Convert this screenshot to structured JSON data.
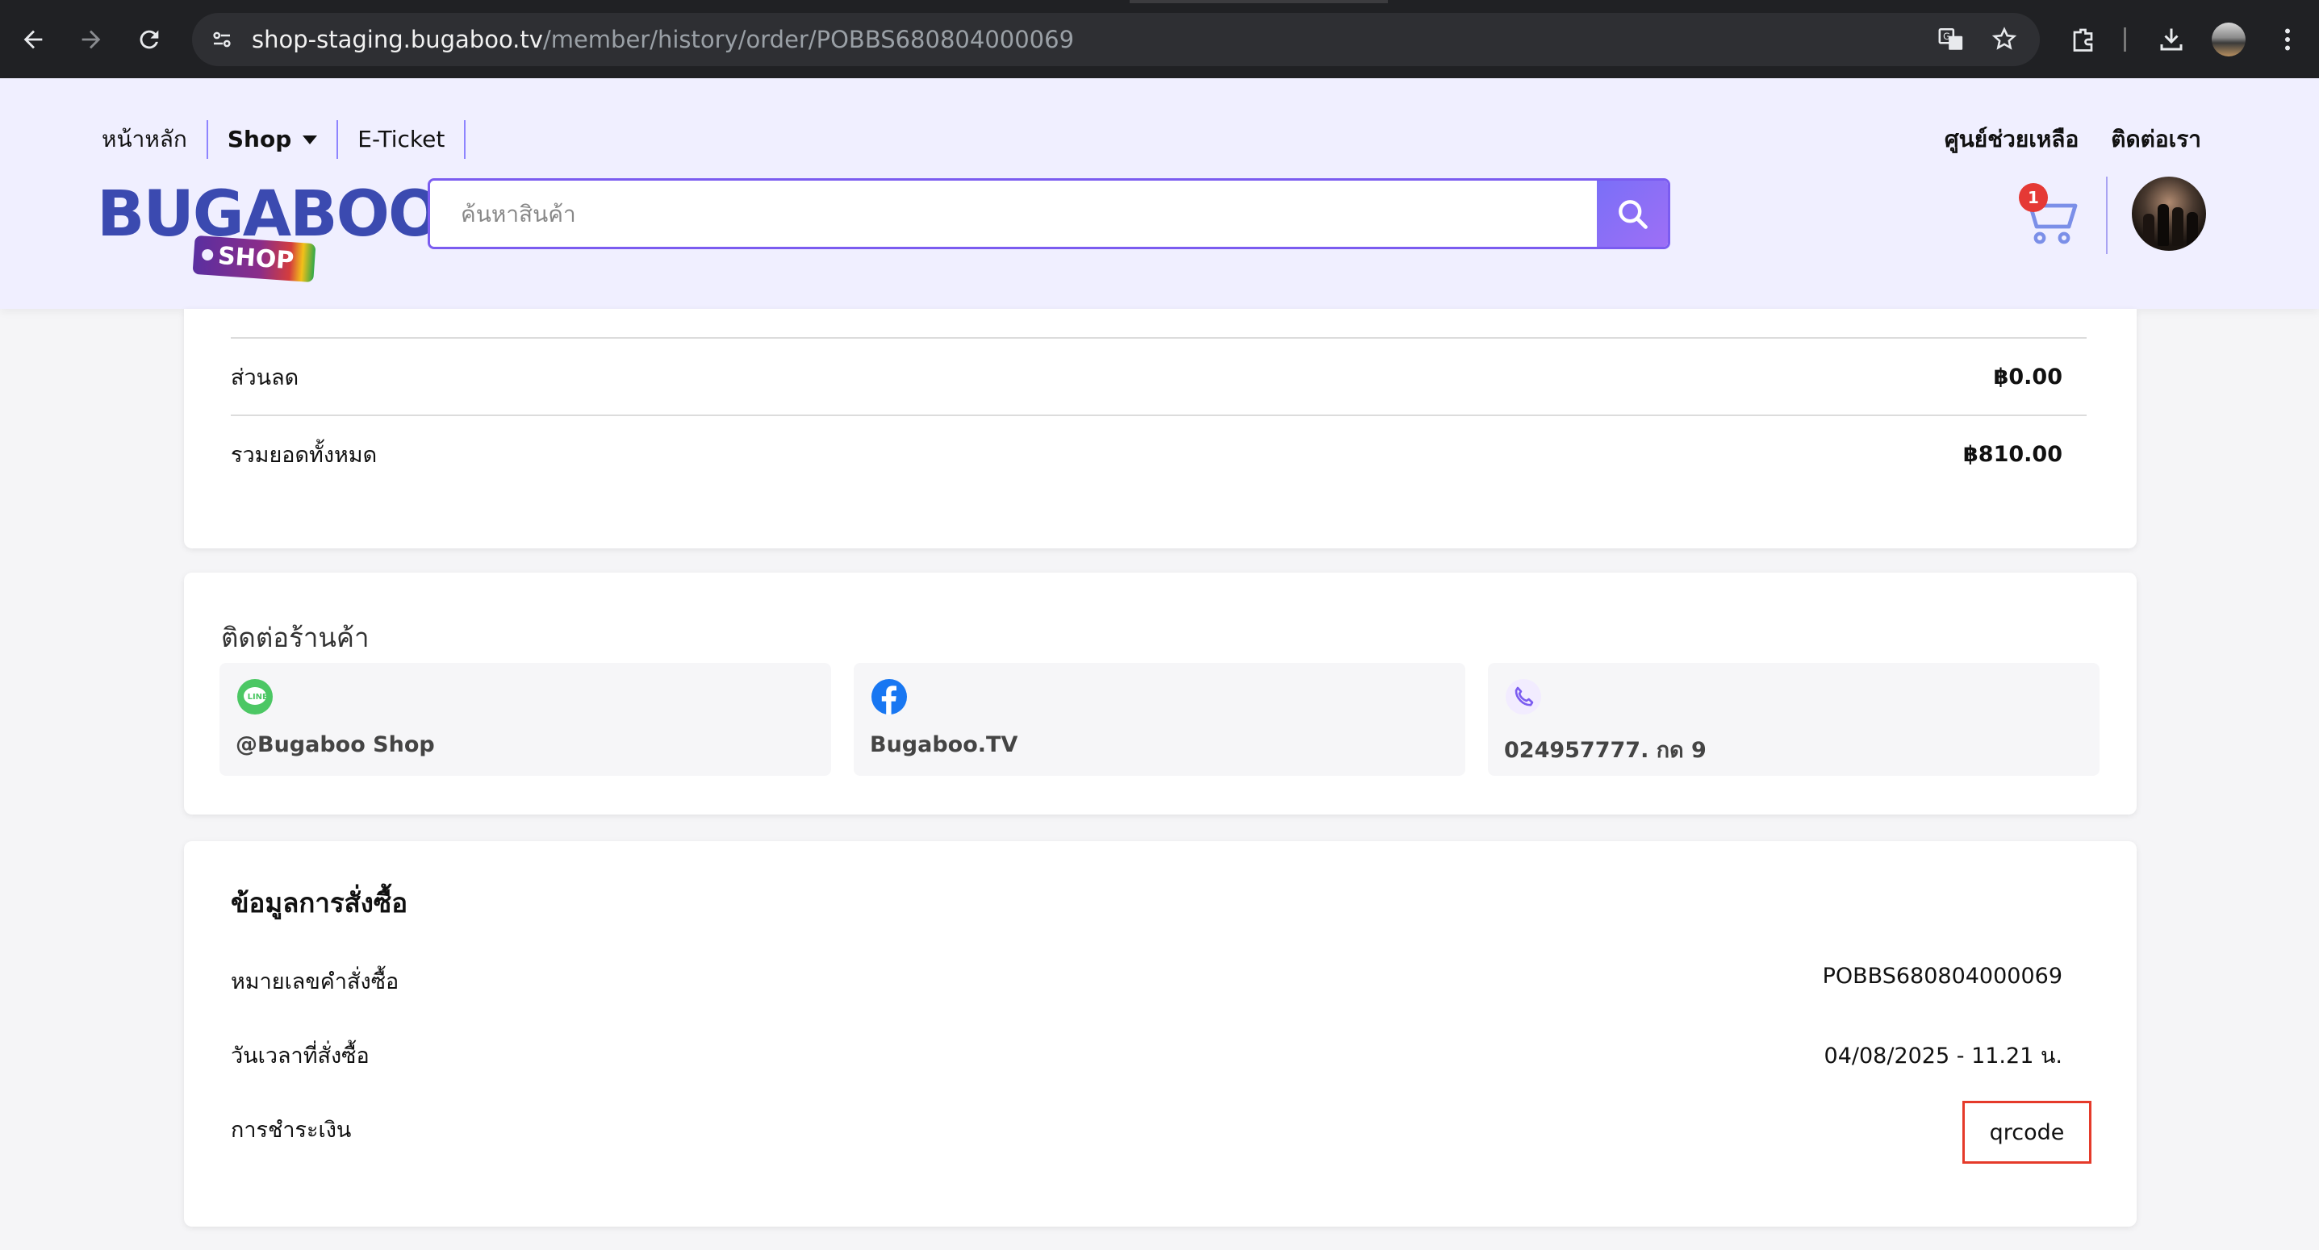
{
  "browser": {
    "url_host": "shop-staging.bugaboo.tv",
    "url_path": "/member/history/order/POBBS680804000069"
  },
  "header": {
    "nav": {
      "home": "หน้าหลัก",
      "shop": "Shop",
      "eticket": "E-Ticket",
      "help": "ศูนย์ช่วยเหลือ",
      "contact": "ติดต่อเรา"
    },
    "logo": {
      "text": "BUGABOO",
      "tag": "SHOP"
    },
    "search": {
      "placeholder": "ค้นหาสินค้า"
    },
    "cart": {
      "count": "1"
    }
  },
  "summary": {
    "rows": [
      {
        "label": "ส่วนลด",
        "value": "฿0.00"
      },
      {
        "label": "รวมยอดทั้งหมด",
        "value": "฿810.00"
      }
    ]
  },
  "contact_store": {
    "title": "ติดต่อร้านค้า",
    "items": [
      {
        "icon": "line-icon",
        "text": "@Bugaboo Shop"
      },
      {
        "icon": "facebook-icon",
        "text": "Bugaboo.TV"
      },
      {
        "icon": "phone-icon",
        "text": "024957777. กด 9"
      }
    ]
  },
  "order_info": {
    "title": "ข้อมูลการสั่งซื้อ",
    "order_number_label": "หมายเลขคำสั่งซื้อ",
    "order_number": "POBBS680804000069",
    "order_date_label": "วันเวลาที่สั่งซื้อ",
    "order_date": "04/08/2025 - 11.21 น.",
    "payment_label": "การชำระเงิน",
    "payment_value": "qrcode"
  },
  "colors": {
    "accent": "#7b5cf0",
    "header_bg": "#f0efff",
    "badge_red": "#e53935",
    "highlight_border": "#e53a2a"
  }
}
